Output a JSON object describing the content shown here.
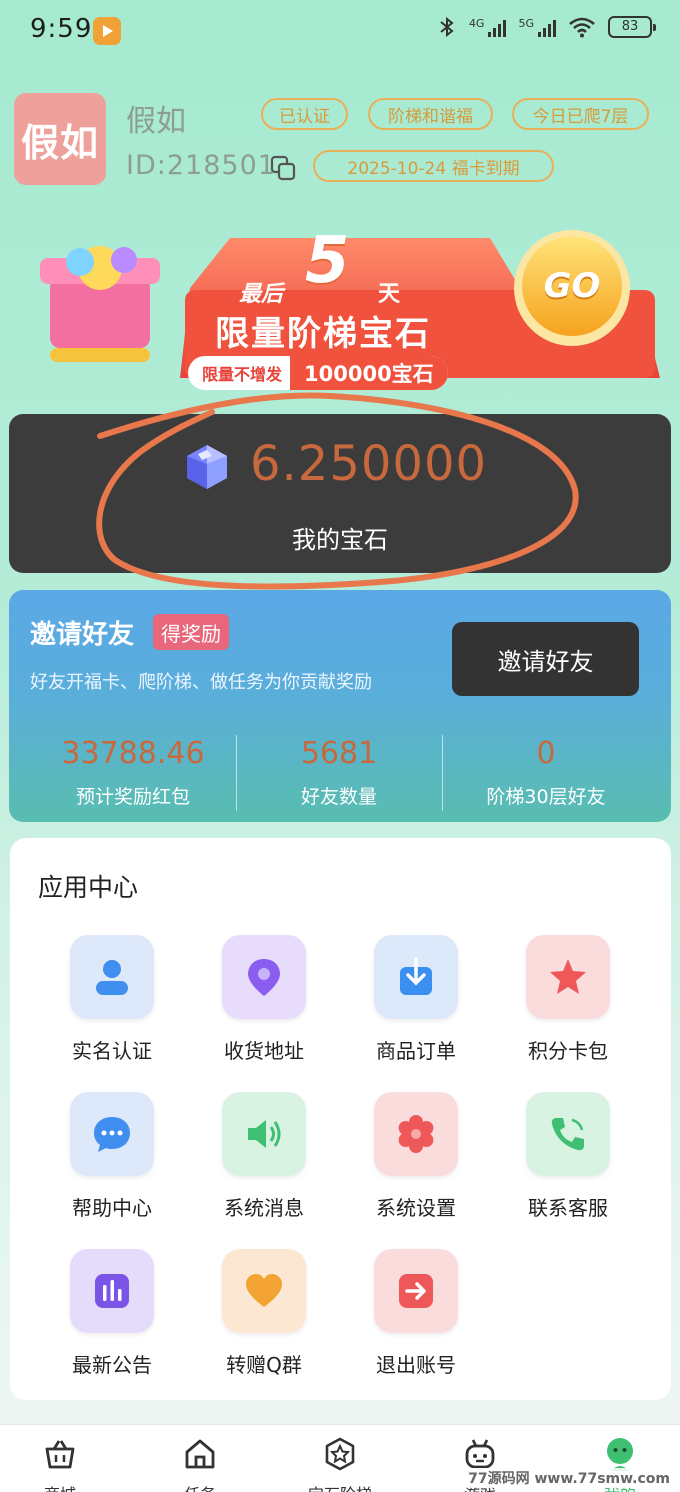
{
  "status_bar": {
    "time": "9:59",
    "net1": "4G",
    "net2": "5G",
    "battery": "83"
  },
  "profile": {
    "avatar_text": "假如",
    "name": "假如",
    "id": "ID:218501",
    "tags": [
      "已认证",
      "阶梯和谐福",
      "今日已爬7层",
      "2025-10-24 福卡到期"
    ]
  },
  "banner": {
    "line1": "最后",
    "number": "5",
    "line1b": "天",
    "title": "限量阶梯宝石",
    "pill_left": "限量不增发",
    "pill_right": "100000宝石",
    "go": "GO"
  },
  "gems": {
    "value": "6.250000",
    "label": "我的宝石"
  },
  "invite": {
    "title": "邀请好友",
    "badge": "得奖励",
    "subtitle": "好友开福卡、爬阶梯、做任务为你贡献奖励",
    "button": "邀请好友",
    "stats": [
      {
        "value": "33788.46",
        "label": "预计奖励红包"
      },
      {
        "value": "5681",
        "label": "好友数量"
      },
      {
        "value": "0",
        "label": "阶梯30层好友"
      }
    ]
  },
  "app_center": {
    "title": "应用中心",
    "items": [
      {
        "label": "实名认证",
        "icon": "user-verify-icon",
        "color": "#3f8ef0"
      },
      {
        "label": "收货地址",
        "icon": "location-pin-icon",
        "color": "#8a5cf0"
      },
      {
        "label": "商品订单",
        "icon": "order-download-icon",
        "color": "#3a8ff0"
      },
      {
        "label": "积分卡包",
        "icon": "star-icon",
        "color": "#ef5858"
      },
      {
        "label": "帮助中心",
        "icon": "chat-bubble-icon",
        "color": "#3f8ef0"
      },
      {
        "label": "系统消息",
        "icon": "speaker-icon",
        "color": "#3fbf72"
      },
      {
        "label": "系统设置",
        "icon": "gear-icon",
        "color": "#ef5858"
      },
      {
        "label": "联系客服",
        "icon": "phone-icon",
        "color": "#3fbf72"
      },
      {
        "label": "最新公告",
        "icon": "bar-chart-icon",
        "color": "#7b55e8"
      },
      {
        "label": "转赠Q群",
        "icon": "heart-icon",
        "color": "#f2a334"
      },
      {
        "label": "退出账号",
        "icon": "logout-arrow-icon",
        "color": "#ef5858"
      }
    ]
  },
  "bottom_nav": [
    {
      "label": "商城",
      "icon": "basket-icon"
    },
    {
      "label": "任务",
      "icon": "home-icon"
    },
    {
      "label": "宝石阶梯",
      "icon": "star-badge-icon"
    },
    {
      "label": "游戏",
      "icon": "robot-icon"
    },
    {
      "label": "我的",
      "icon": "profile-icon",
      "active": true
    }
  ],
  "watermark": "77源码网 www.77smw.com"
}
